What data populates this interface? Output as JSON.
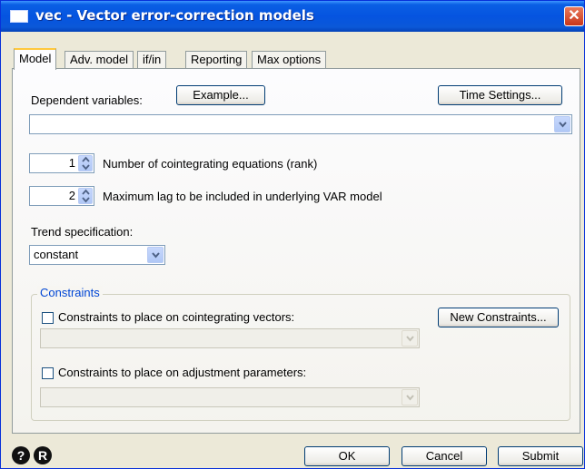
{
  "window": {
    "title": "vec - Vector error-correction models",
    "close_glyph": "✕"
  },
  "tabs": [
    {
      "label": "Model",
      "active": true
    },
    {
      "label": "Adv. model",
      "active": false
    },
    {
      "label": "if/in",
      "active": false
    },
    {
      "label": "Reporting",
      "active": false
    },
    {
      "label": "Max options",
      "active": false
    }
  ],
  "model": {
    "dependent_label": "Dependent variables:",
    "example_button": "Example...",
    "time_settings_button": "Time Settings...",
    "dependent_value": "",
    "rank": {
      "value": "1",
      "label": "Number of cointegrating equations (rank)"
    },
    "lags": {
      "value": "2",
      "label": "Maximum lag to be included in underlying VAR model"
    },
    "trend_label": "Trend specification:",
    "trend_value": "constant"
  },
  "constraints": {
    "legend": "Constraints",
    "cointegrating_label": "Constraints to place on cointegrating vectors:",
    "cointegrating_checked": false,
    "new_constraints_button": "New Constraints...",
    "adjustment_label": "Constraints to place on adjustment parameters:",
    "adjustment_checked": false
  },
  "footer": {
    "help_icon": "?",
    "reset_icon": "R",
    "ok_button": "OK",
    "cancel_button": "Cancel",
    "submit_button": "Submit"
  },
  "icons": {
    "help": "help-icon",
    "reset": "reset-icon",
    "dropdown": "chevron-down-icon",
    "spinner": "spinner-arrows-icon"
  },
  "colors": {
    "titlebar": "#0554e0",
    "window_bg": "#ece9d8",
    "group_legend": "#0046d5",
    "active_tab_accent": "#ffc83c"
  }
}
